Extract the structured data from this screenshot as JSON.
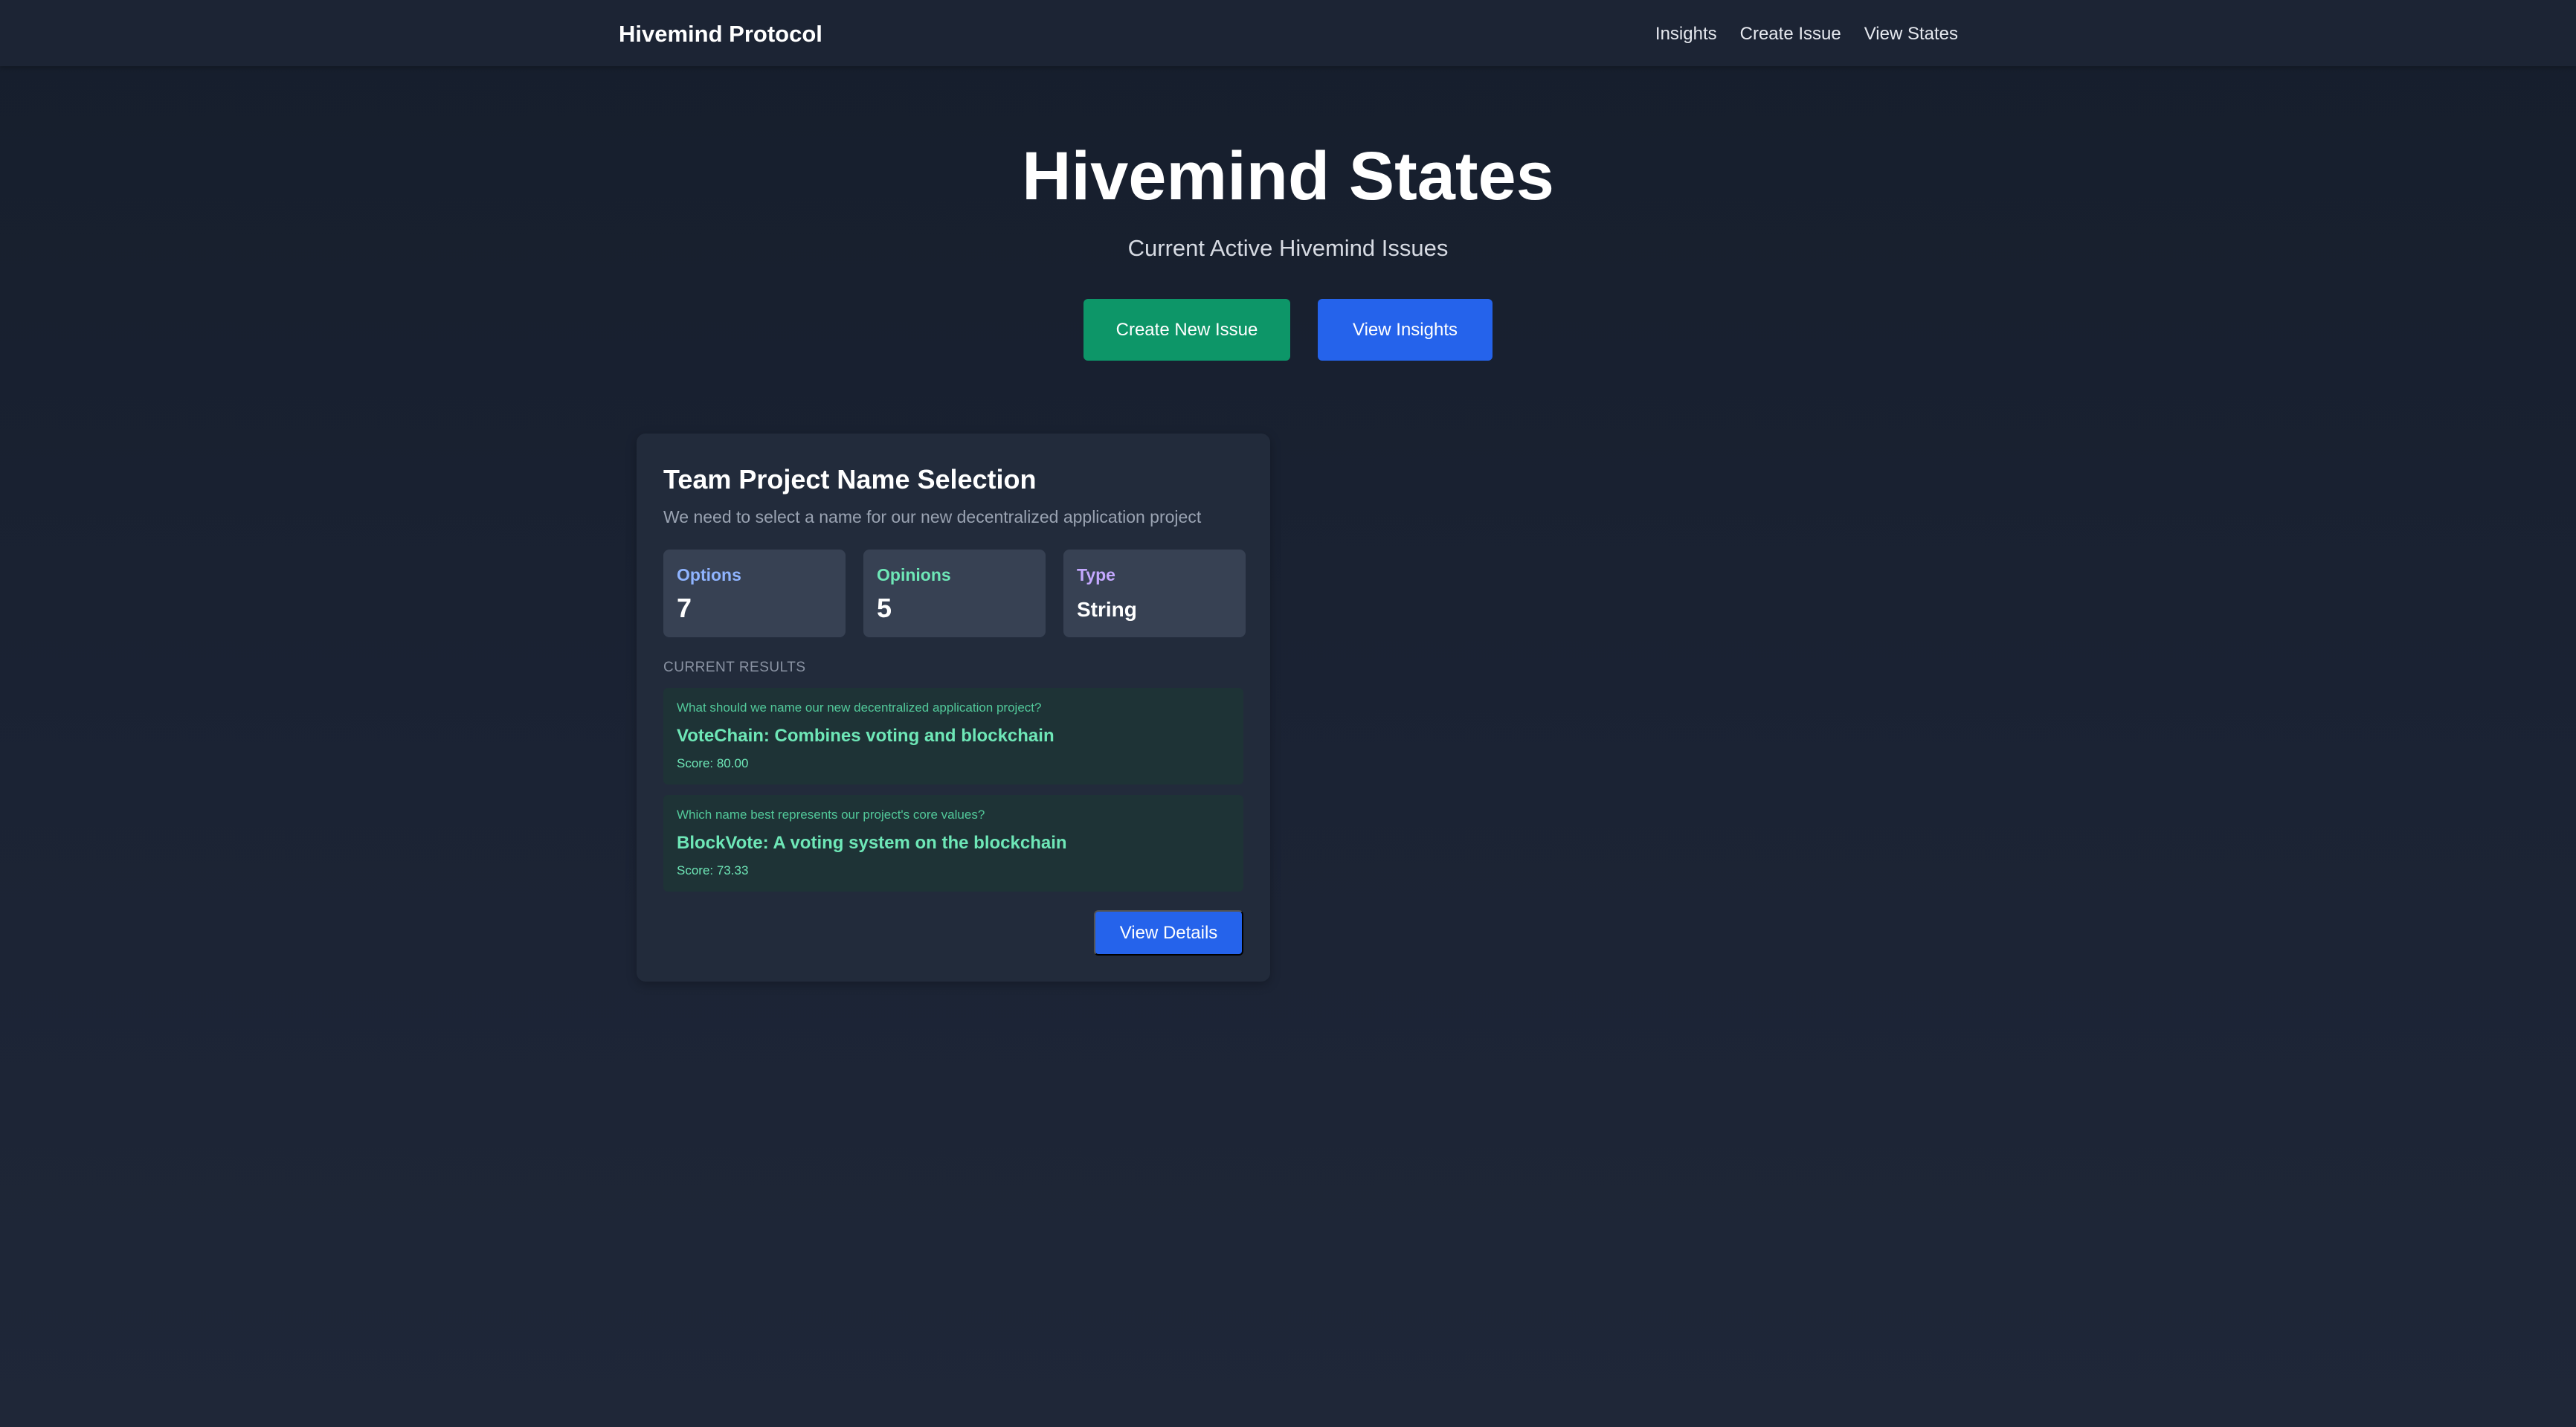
{
  "navbar": {
    "brand": "Hivemind Protocol",
    "links": [
      "Insights",
      "Create Issue",
      "View States"
    ]
  },
  "hero": {
    "title": "Hivemind States",
    "subtitle": "Current Active Hivemind Issues",
    "primary_button": "Create New Issue",
    "secondary_button": "View Insights"
  },
  "colors": {
    "accent_green": "#0d9668",
    "accent_blue": "#2563eb",
    "result_text": "#6ee7b7"
  },
  "issue_card": {
    "title": "Team Project Name Selection",
    "description": "We need to select a name for our new decentralized application project",
    "stats": [
      {
        "label": "Options",
        "value": "7"
      },
      {
        "label": "Opinions",
        "value": "5"
      },
      {
        "label": "Type",
        "value": "String"
      }
    ],
    "results_heading": "CURRENT RESULTS",
    "results": [
      {
        "question": "What should we name our new decentralized application project?",
        "answer": "VoteChain: Combines voting and blockchain",
        "score": "Score: 80.00"
      },
      {
        "question": "Which name best represents our project's core values?",
        "answer": "BlockVote: A voting system on the blockchain",
        "score": "Score: 73.33"
      }
    ],
    "details_button": "View Details"
  }
}
